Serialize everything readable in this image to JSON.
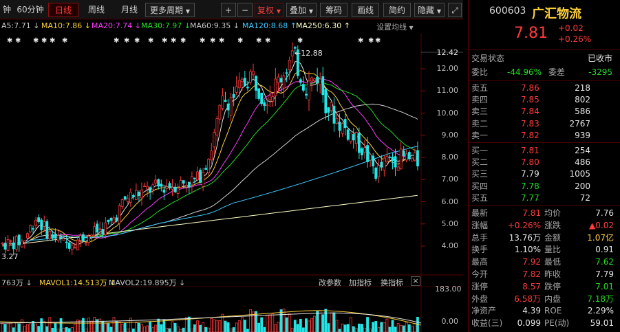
{
  "toolbar": {
    "items": [
      "钟",
      "60分钟",
      "日线",
      "周线",
      "月线",
      "更多周期",
      "+",
      "−",
      "复权",
      "叠加",
      "筹码",
      "画线",
      "简约",
      "隐藏"
    ],
    "active": "日线"
  },
  "ma_legend": {
    "items": [
      {
        "text": "A5:7.71 ↓",
        "color": "#e6e6e6"
      },
      {
        "text": "MA10:7.86 ↓",
        "color": "#ffd23c"
      },
      {
        "text": "MA20:7.74 ↓",
        "color": "#ff3cff"
      },
      {
        "text": "MA30:7.97 ↓",
        "color": "#22dd22"
      },
      {
        "text": "MA60:9.35 ↓",
        "color": "#e6e6e6"
      },
      {
        "text": "MA120:8.68 ↑",
        "color": "#3cc8ff"
      },
      {
        "text": "MA250:6.30 ↑",
        "color": "#ffffc8"
      }
    ],
    "settings": "设置均线"
  },
  "annotations": {
    "high": "12.88",
    "low": "3.27"
  },
  "chart_data": {
    "type": "candlestick",
    "price_axis": {
      "ticks": [
        12.42,
        12.0,
        11.0,
        10.0,
        9.0,
        8.0,
        7.0,
        6.0,
        5.0,
        4.0
      ],
      "current": 12.42
    },
    "volume_axis": {
      "ticks": [
        183.0,
        0.0
      ]
    },
    "high": 12.88,
    "low": 3.27
  },
  "sub_legend": {
    "items": [
      {
        "text": "763万 ↓",
        "color": "#e6e6e6"
      },
      {
        "text": "MAVOL1:14.513万 ↓",
        "color": "#ffd23c"
      },
      {
        "text": "MAVOL2:19.895万 ↓",
        "color": "#e6e6e6"
      }
    ],
    "actions": [
      "改参数",
      "加指标",
      "换指标"
    ]
  },
  "stock": {
    "code": "600603",
    "name": "广汇物流",
    "price": "7.81",
    "change": "+0.02",
    "change_pct": "+0.26%"
  },
  "status": {
    "label": "交易状态",
    "value": "已收市"
  },
  "wei": {
    "bi_label": "委比",
    "bi_value": "-44.96%",
    "cha_label": "委差",
    "cha_value": "-3295"
  },
  "sells": [
    {
      "label": "卖五",
      "price": "7.86",
      "vol": "218"
    },
    {
      "label": "卖四",
      "price": "7.85",
      "vol": "802"
    },
    {
      "label": "卖三",
      "price": "7.84",
      "vol": "586"
    },
    {
      "label": "卖二",
      "price": "7.83",
      "vol": "2767"
    },
    {
      "label": "卖一",
      "price": "7.82",
      "vol": "939"
    }
  ],
  "buys": [
    {
      "label": "买一",
      "price": "7.81",
      "vol": "254"
    },
    {
      "label": "买二",
      "price": "7.80",
      "vol": "486"
    },
    {
      "label": "买三",
      "price": "7.79",
      "vol": "1005"
    },
    {
      "label": "买四",
      "price": "7.78",
      "vol": "200"
    },
    {
      "label": "买五",
      "price": "7.77",
      "vol": "72"
    }
  ],
  "stats": [
    {
      "l1": "最新",
      "v1": "7.81",
      "c1": "red",
      "l2": "均价",
      "v2": "7.76",
      "c2": "white"
    },
    {
      "l1": "涨幅",
      "v1": "+0.26%",
      "c1": "red",
      "l2": "涨跌",
      "v2": "▲0.02",
      "c2": "red"
    },
    {
      "l1": "总手",
      "v1": "13.76万",
      "c1": "white",
      "l2": "金额",
      "v2": "1.07亿",
      "c2": "yellow"
    },
    {
      "l1": "换手",
      "v1": "1.10%",
      "c1": "white",
      "l2": "量比",
      "v2": "0.91",
      "c2": "white"
    },
    {
      "l1": "最高",
      "v1": "7.92",
      "c1": "red",
      "l2": "最低",
      "v2": "7.62",
      "c2": "green"
    },
    {
      "l1": "今开",
      "v1": "7.82",
      "c1": "red",
      "l2": "昨收",
      "v2": "7.79",
      "c2": "white"
    },
    {
      "l1": "涨停",
      "v1": "8.57",
      "c1": "red",
      "l2": "跌停",
      "v2": "7.01",
      "c2": "green"
    },
    {
      "l1": "外盘",
      "v1": "6.58万",
      "c1": "red",
      "l2": "内盘",
      "v2": "7.18万",
      "c2": "green"
    },
    {
      "l1": "净资产",
      "v1": "4.39",
      "c1": "white",
      "l2": "ROE",
      "v2": "2.29%",
      "c2": "white"
    },
    {
      "l1": "收益(三)",
      "v1": "0.099",
      "c1": "white",
      "l2": "PE(动)",
      "v2": "59.01",
      "c2": "white"
    }
  ]
}
